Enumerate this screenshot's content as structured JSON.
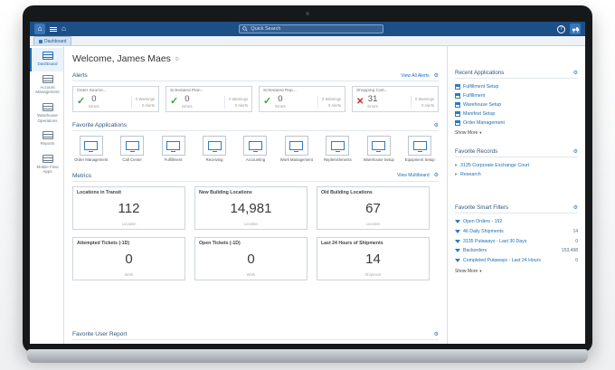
{
  "topbar": {
    "search_placeholder": "Quick Search"
  },
  "tab": {
    "label": "Dashboard"
  },
  "sidebar": {
    "items": [
      {
        "label": "Dashboard"
      },
      {
        "label": "Account Management"
      },
      {
        "label": "Warehouse Operations"
      },
      {
        "label": "Reports"
      },
      {
        "label": "Mobile Flow Apps"
      }
    ]
  },
  "main": {
    "welcome": "Welcome, James Maes",
    "alerts": {
      "title": "Alerts",
      "view_all": "View All Alerts",
      "cards": [
        {
          "name": "Order Source...",
          "count": "0",
          "count_label": "Errors",
          "warnings": "0 Warnings",
          "alerts": "0 Alerts",
          "status": "ok"
        },
        {
          "name": "Scheduled Plan...",
          "count": "0",
          "count_label": "Errors",
          "warnings": "0 Warnings",
          "alerts": "0 Alerts",
          "status": "ok"
        },
        {
          "name": "Scheduled Rep...",
          "count": "0",
          "count_label": "Errors",
          "warnings": "0 Warnings",
          "alerts": "0 Alerts",
          "status": "ok"
        },
        {
          "name": "Shopping Cart...",
          "count": "31",
          "count_label": "Errors",
          "warnings": "0 Warnings",
          "alerts": "0 Alerts",
          "status": "error"
        }
      ]
    },
    "favorite_applications": {
      "title": "Favorite Applications",
      "tiles": [
        {
          "label": "Order Management"
        },
        {
          "label": "Call Center"
        },
        {
          "label": "Fulfillment"
        },
        {
          "label": "Receiving"
        },
        {
          "label": "Accounting"
        },
        {
          "label": "Work Management"
        },
        {
          "label": "Replenishments"
        },
        {
          "label": "Warehouse Setup"
        },
        {
          "label": "Equipment Setup"
        }
      ]
    },
    "metrics": {
      "title": "Metrics",
      "view_link": "View Multiboard",
      "cards": [
        {
          "name": "Locations in Transit",
          "value": "112",
          "unit": "Location"
        },
        {
          "name": "New Building Locations",
          "value": "14,981",
          "unit": "Location"
        },
        {
          "name": "Old Building Locations",
          "value": "67",
          "unit": "Location"
        },
        {
          "name": "Attempted Tickets (-1D)",
          "value": "0",
          "unit": "Work"
        },
        {
          "name": "Open Tickets (-1D)",
          "value": "0",
          "unit": "Work"
        },
        {
          "name": "Last 24 Hours of Shipments",
          "value": "14",
          "unit": "Shipment"
        }
      ]
    },
    "favorite_user_report": {
      "title": "Favorite User Report"
    }
  },
  "right_panel": {
    "recent_applications": {
      "title": "Recent Applications",
      "items": [
        {
          "label": "Fulfillment Setup"
        },
        {
          "label": "Fulfillment"
        },
        {
          "label": "Warehouse Setup"
        },
        {
          "label": "Manifest Setup"
        },
        {
          "label": "Order Management"
        }
      ],
      "show_more": "Show More"
    },
    "favorite_records": {
      "title": "Favorite Records",
      "items": [
        {
          "label": "3135 Corporate Exchange Court"
        },
        {
          "label": "Research"
        }
      ]
    },
    "favorite_smart_filters": {
      "title": "Favorite Smart Filters",
      "items": [
        {
          "label": "Open Orders - 192",
          "count": ""
        },
        {
          "label": "46 Daily Shipments",
          "count": "14"
        },
        {
          "label": "3135 Putaways - Last 30 Days",
          "count": "0"
        },
        {
          "label": "Backorders",
          "count": "153,498"
        },
        {
          "label": "Completed Putaways - Last 24 Hours",
          "count": "0"
        }
      ],
      "show_more": "Show More"
    }
  }
}
